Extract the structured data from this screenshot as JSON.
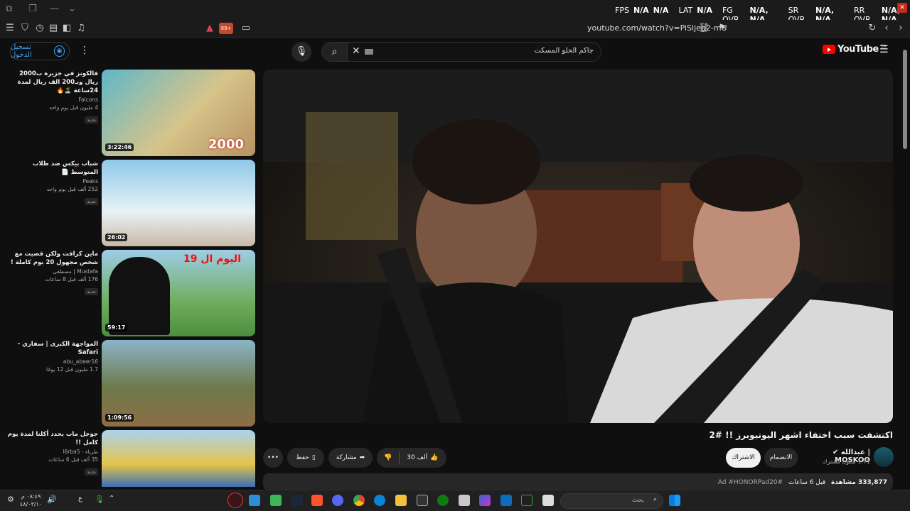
{
  "overlay": {
    "fps_label": "FPS",
    "fps_value": "N/A",
    "fps_value2": "N/A",
    "lat_label": "LAT",
    "lat_value": "N/A",
    "fg_label": "FG OVR",
    "fg_value": "N/A, N/A",
    "sr_label": "SR OVR",
    "sr_value": "N/A, N/A",
    "rr_label": "RR OVR",
    "rr_value": "N/A, N/A"
  },
  "browser": {
    "url": "youtube.com/watch?v=PiSljeg2-mU",
    "badge": "99+"
  },
  "header": {
    "signin_label": "تسجيل الدخول",
    "search_query": "جاكم الحلو المسكت",
    "logo_text": "YouTube",
    "country_code": "SA"
  },
  "sidebar": {
    "items": [
      {
        "title": "فالكونز في جزيرة ب2000 ريال وبـ200 الف ريال لمدة 24ساعة 🏝️🔥",
        "channel": "Falcons",
        "meta": "4 مليون  قبل يوم واحد",
        "badge": "جديد",
        "duration": "3:22:46",
        "overlay_text": "2000"
      },
      {
        "title": "شباب بيكس ضد طلاب المتوسط 📄",
        "channel": "Peaks",
        "meta": "252 ألف  قبل يوم واحد",
        "badge": "جديد",
        "duration": "26:02"
      },
      {
        "title": "ماين كرافت ولكن قضيت مع شخص مجهول 20 يوم كاملة !",
        "channel": "Mustafa | مصطفى",
        "meta": "176 ألف  قبل 8 ساعات",
        "badge": "جديد",
        "duration": "59:17",
        "overlay_text": "اليوم ال 19"
      },
      {
        "title": "المواجهة الكبرى | سفاري - Safari",
        "channel": "abu_abeer16",
        "meta": "1.7 مليون  قبل 12 يومًا",
        "badge": "",
        "duration": "1:09:56"
      },
      {
        "title": "جوجل ماب يحدد أكلنا لمدة يوم كامل !!",
        "channel": "طرباء - l6rba5",
        "meta": "35 ألف  قبل 6 ساعات",
        "badge": "جديد",
        "duration": ""
      }
    ]
  },
  "video": {
    "title": "اكتشفت سبب اختفاء اشهر اليوتيوبرز !! #2",
    "channel_name": "عبدالله | MOSKOO",
    "subscribers": "1.71 مليون مشترك",
    "subscribe_label": "الاشتراك",
    "join_label": "الانضمام",
    "likes": "30 ألف",
    "share_label": "مشاركة",
    "save_label": "حفظ",
    "views": "333,877 مشاهدة",
    "time_ago": "قبل 6 ساعات",
    "hashtags": "#Ad #HONORPad20"
  },
  "taskbar": {
    "search_placeholder": "بحث",
    "time": "٠٨:٤٩ م",
    "date": "٤٨/٠٣/١٠",
    "lang": "ع"
  }
}
